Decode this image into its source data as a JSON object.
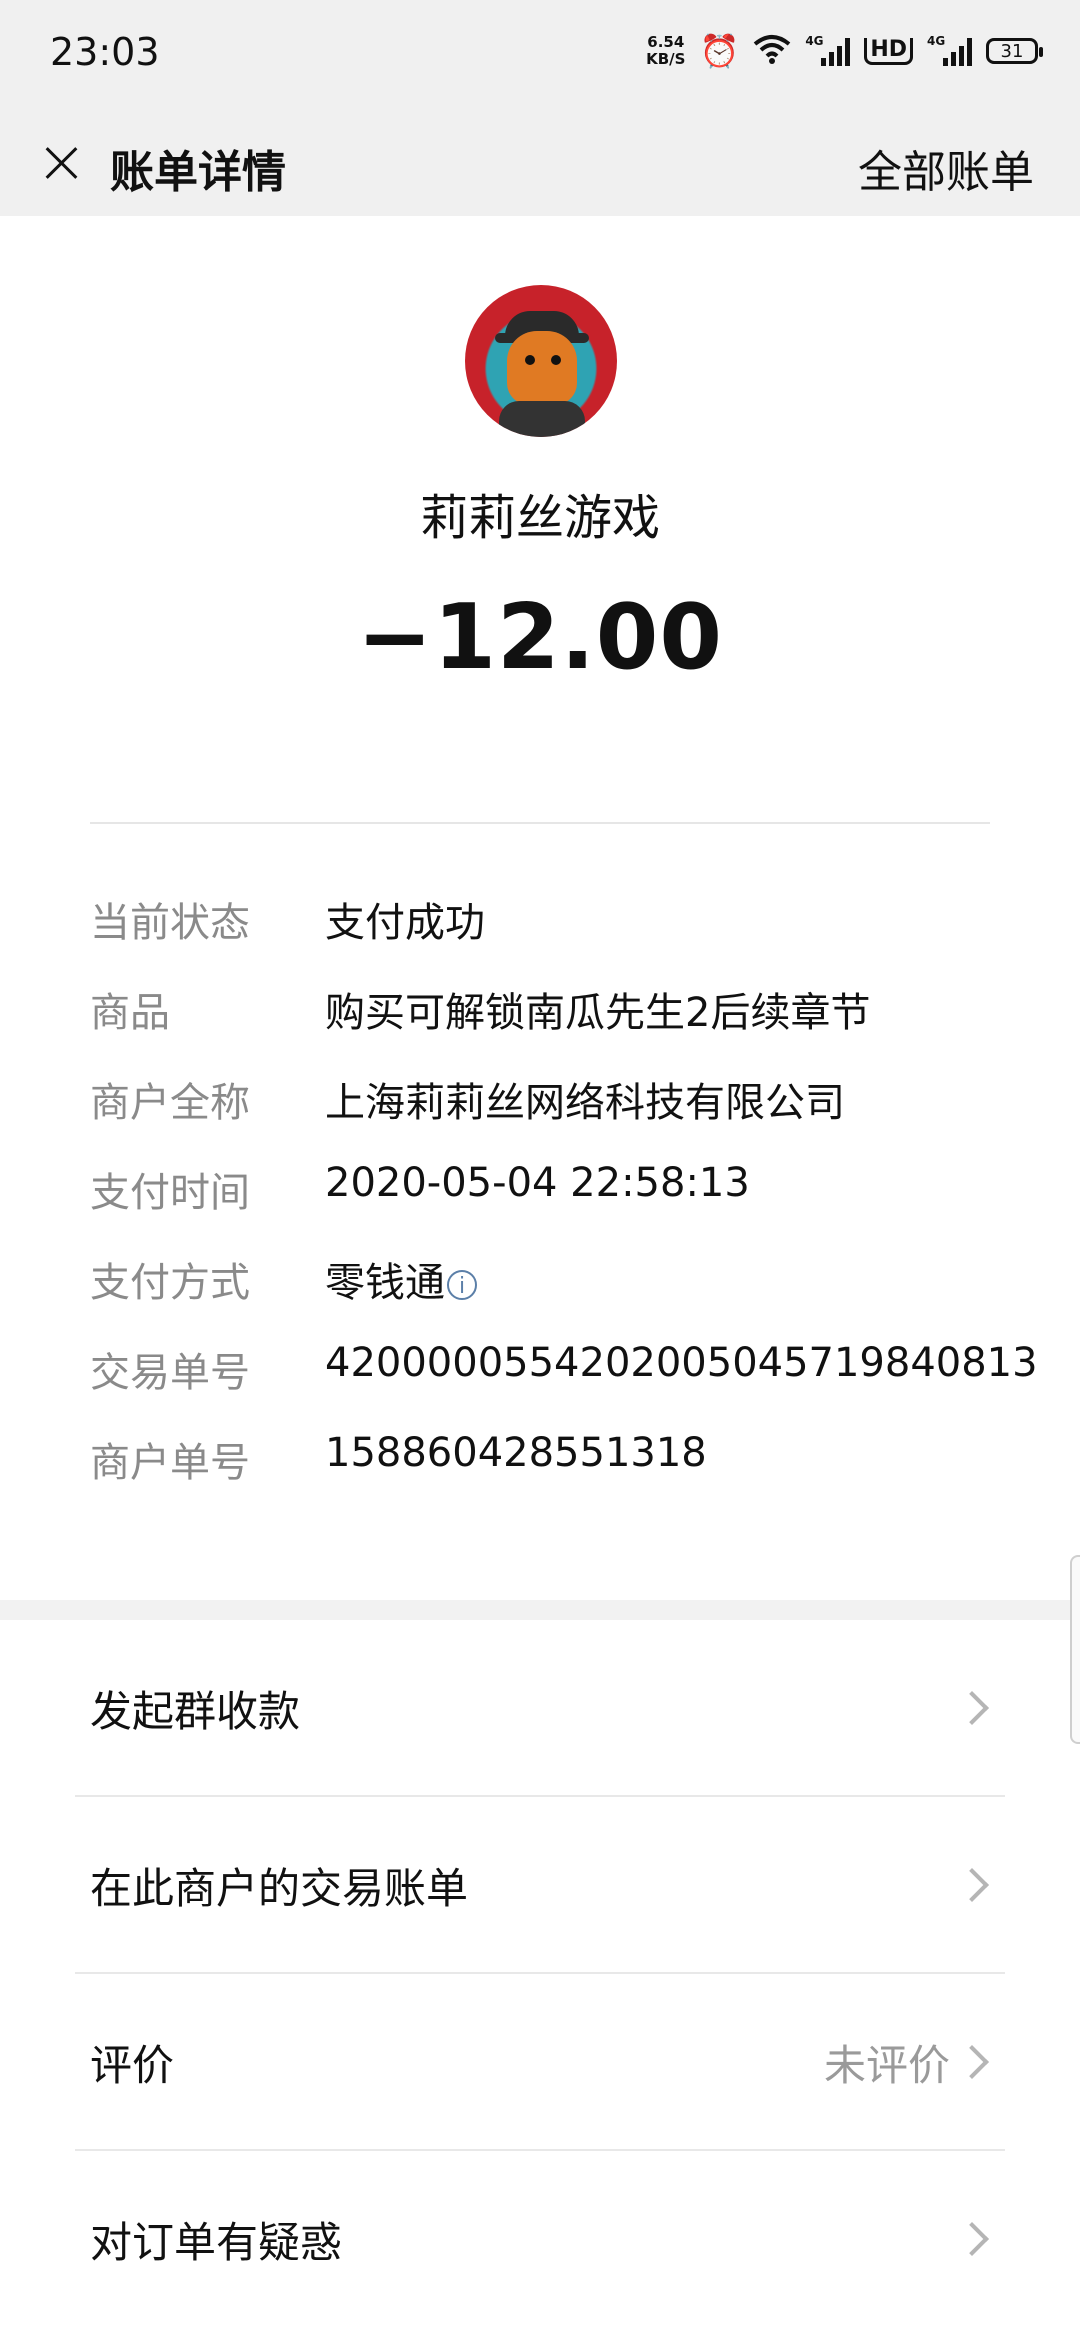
{
  "status_bar": {
    "time": "23:03",
    "net_speed_value": "6.54",
    "net_speed_unit": "KB/S",
    "signal_tag": "4G",
    "hd_label": "HD",
    "battery": "31"
  },
  "header": {
    "title": "账单详情",
    "all_bills": "全部账单"
  },
  "merchant": {
    "name": "莉莉丝游戏",
    "amount": "−12.00"
  },
  "details": [
    {
      "label": "当前状态",
      "value": "支付成功"
    },
    {
      "label": "商品",
      "value": "购买可解锁南瓜先生2后续章节"
    },
    {
      "label": "商户全称",
      "value": "上海莉莉丝网络科技有限公司"
    },
    {
      "label": "支付时间",
      "value": "2020-05-04 22:58:13"
    },
    {
      "label": "支付方式",
      "value": "零钱通",
      "info": "i"
    },
    {
      "label": "交易单号",
      "value": "4200000554202005045719840813"
    },
    {
      "label": "商户单号",
      "value": "158860428551318"
    }
  ],
  "menu": [
    {
      "label": "发起群收款"
    },
    {
      "label": "在此商户的交易账单"
    },
    {
      "label": "评价",
      "right": "未评价"
    },
    {
      "label": "对订单有疑惑"
    }
  ]
}
